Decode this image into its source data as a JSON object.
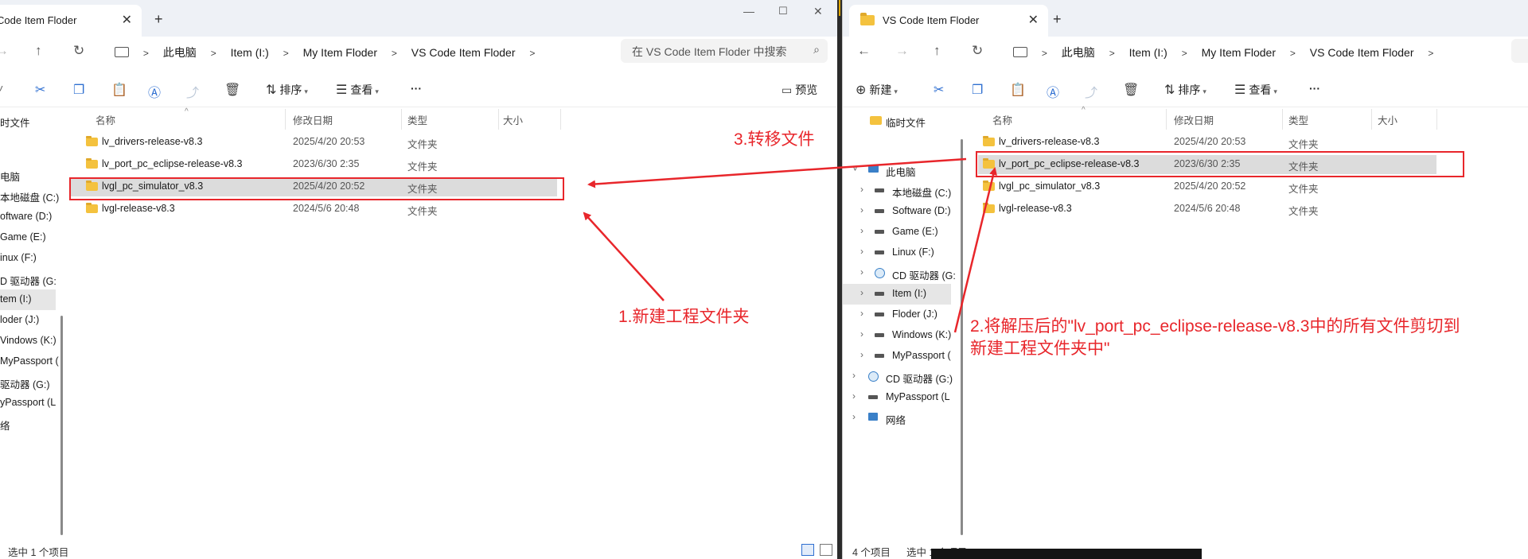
{
  "colors": {
    "accent": "#2f6fd1",
    "folder": "#f4c23e",
    "annotation": "#e8262b",
    "selected_row": "#dcdcdc"
  },
  "left": {
    "tab_title": "Code Item Floder",
    "new_tab": "+",
    "tab_close": "✕",
    "window_controls": [
      "—",
      "☐",
      "✕"
    ],
    "nav": {
      "forward": "→",
      "up": "↑",
      "refresh": "↻"
    },
    "breadcrumb": [
      "此电脑",
      "Item (I:)",
      "My Item Floder",
      "VS Code Item Floder"
    ],
    "search_placeholder": "在 VS Code Item Floder 中搜索",
    "commands": {
      "sort": "排序",
      "view": "查看",
      "more": "···",
      "preview": "预览"
    },
    "sidebar": [
      {
        "label": "时文件",
        "icon": "folder-icon"
      },
      {
        "label": "电脑",
        "icon": "pc-icon"
      },
      {
        "label": "本地磁盘 (C:)",
        "icon": "drive-icon"
      },
      {
        "label": "oftware (D:)",
        "icon": "drive-icon"
      },
      {
        "label": "Game (E:)",
        "icon": "drive-icon"
      },
      {
        "label": "inux (F:)",
        "icon": "drive-icon"
      },
      {
        "label": "D 驱动器 (G:",
        "icon": "cd-icon"
      },
      {
        "label": "tem (I:)",
        "icon": "drive-icon",
        "selected": true
      },
      {
        "label": "loder (J:)",
        "icon": "drive-icon"
      },
      {
        "label": "Vindows (K:)",
        "icon": "drive-icon"
      },
      {
        "label": "MyPassport (",
        "icon": "drive-icon"
      },
      {
        "label": "驱动器 (G:)",
        "icon": "cd-icon"
      },
      {
        "label": "yPassport (L",
        "icon": "drive-icon"
      },
      {
        "label": "络",
        "icon": "network-icon"
      }
    ],
    "columns": [
      "名称",
      "修改日期",
      "类型",
      "大小"
    ],
    "files": [
      {
        "name": "lv_drivers-release-v8.3",
        "date": "2025/4/20 20:53",
        "type": "文件夹",
        "size": ""
      },
      {
        "name": "lv_port_pc_eclipse-release-v8.3",
        "date": "2023/6/30 2:35",
        "type": "文件夹",
        "size": ""
      },
      {
        "name": "lvgl_pc_simulator_v8.3",
        "date": "2025/4/20 20:52",
        "type": "文件夹",
        "size": "",
        "selected": true
      },
      {
        "name": "lvgl-release-v8.3",
        "date": "2024/5/6 20:48",
        "type": "文件夹",
        "size": ""
      }
    ],
    "status": "选中 1 个项目"
  },
  "right": {
    "tab_title": "VS Code Item Floder",
    "new_tab": "+",
    "tab_close": "✕",
    "nav": {
      "back": "←",
      "forward": "→",
      "up": "↑",
      "refresh": "↻"
    },
    "breadcrumb": [
      "此电脑",
      "Item (I:)",
      "My Item Floder",
      "VS Code Item Floder"
    ],
    "commands": {
      "new": "新建",
      "sort": "排序",
      "view": "查看",
      "more": "···"
    },
    "sidebar": [
      {
        "label": "临时文件",
        "icon": "folder-icon"
      },
      {
        "label": "此电脑",
        "icon": "pc-icon",
        "expanded": true
      },
      {
        "label": "本地磁盘 (C:)",
        "icon": "drive-icon"
      },
      {
        "label": "Software (D:)",
        "icon": "drive-icon"
      },
      {
        "label": "Game (E:)",
        "icon": "drive-icon"
      },
      {
        "label": "Linux (F:)",
        "icon": "drive-icon"
      },
      {
        "label": "CD 驱动器 (G:",
        "icon": "cd-icon"
      },
      {
        "label": "Item (I:)",
        "icon": "drive-icon",
        "selected": true
      },
      {
        "label": "Floder (J:)",
        "icon": "drive-icon"
      },
      {
        "label": "Windows (K:)",
        "icon": "drive-icon"
      },
      {
        "label": "MyPassport (",
        "icon": "drive-icon"
      },
      {
        "label": "CD 驱动器 (G:)",
        "icon": "cd-icon"
      },
      {
        "label": "MyPassport (L",
        "icon": "drive-icon"
      },
      {
        "label": "网络",
        "icon": "network-icon"
      }
    ],
    "columns": [
      "名称",
      "修改日期",
      "类型",
      "大小"
    ],
    "files": [
      {
        "name": "lv_drivers-release-v8.3",
        "date": "2025/4/20 20:53",
        "type": "文件夹",
        "size": ""
      },
      {
        "name": "lv_port_pc_eclipse-release-v8.3",
        "date": "2023/6/30 2:35",
        "type": "文件夹",
        "size": "",
        "selected": true
      },
      {
        "name": "lvgl_pc_simulator_v8.3",
        "date": "2025/4/20 20:52",
        "type": "文件夹",
        "size": ""
      },
      {
        "name": "lvgl-release-v8.3",
        "date": "2024/5/6 20:48",
        "type": "文件夹",
        "size": ""
      }
    ],
    "status_count": "4 个项目",
    "status_selected": "选中 1 个项目"
  },
  "annotations": {
    "step1": "1.新建工程文件夹",
    "step2_line1": "2.将解压后的\"lv_port_pc_eclipse-release-v8.3中的所有文件剪切到",
    "step2_line2": "新建工程文件夹中\"",
    "step3": "3.转移文件"
  }
}
